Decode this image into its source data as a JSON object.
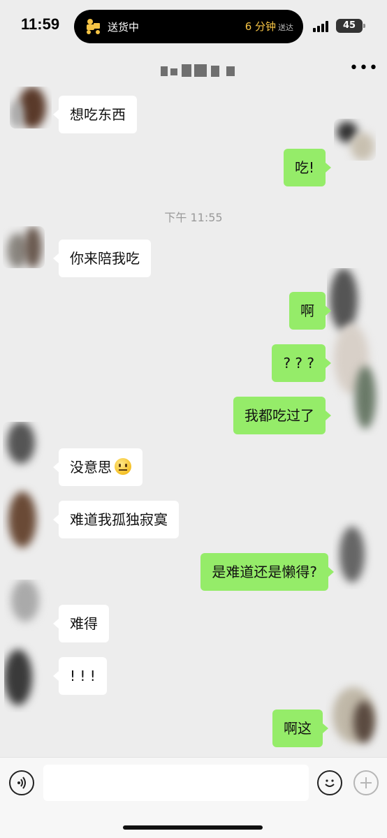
{
  "status_bar": {
    "time": "11:59",
    "activity_label": "送货中",
    "eta": "6 分钟",
    "eta_suffix": "送达",
    "battery": "45"
  },
  "header": {
    "more_icon": "more-dots-icon"
  },
  "chat": {
    "timestamp": "下午 11:55",
    "messages": [
      {
        "side": "left",
        "text": "想吃东西"
      },
      {
        "side": "right",
        "text": "吃!"
      },
      {
        "side": "left",
        "text": "你来陪我吃"
      },
      {
        "side": "right",
        "text": "啊"
      },
      {
        "side": "right",
        "text": "? ? ?"
      },
      {
        "side": "right",
        "text": "我都吃过了"
      },
      {
        "side": "left",
        "text": "没意思",
        "emoji": "neutral-face"
      },
      {
        "side": "left",
        "text": "难道我孤独寂寞"
      },
      {
        "side": "right",
        "text": "是难道还是懒得?"
      },
      {
        "side": "left",
        "text": "难得"
      },
      {
        "side": "left",
        "text": "! ! !"
      },
      {
        "side": "right",
        "text": "啊这"
      }
    ]
  },
  "input_bar": {
    "voice_icon": "voice-icon",
    "emoji_icon": "emoji-icon",
    "plus_icon": "plus-icon",
    "input_value": ""
  },
  "colors": {
    "background": "#ededed",
    "sent_bubble": "#95ec69",
    "received_bubble": "#ffffff",
    "eta_accent": "#f6c445"
  }
}
